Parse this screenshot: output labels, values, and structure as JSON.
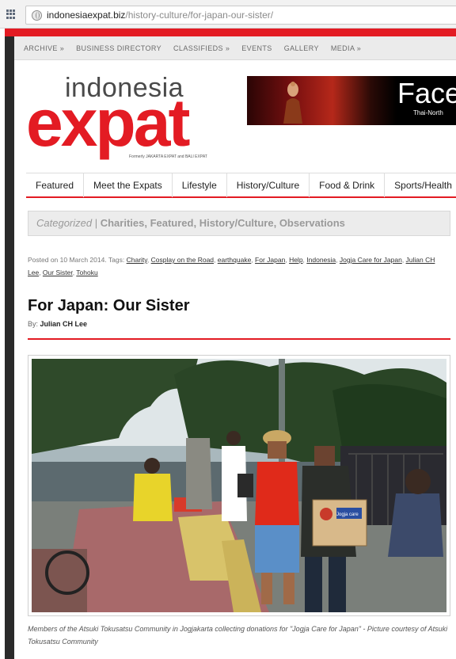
{
  "browser": {
    "url_host": "indonesiaexpat.biz",
    "url_path": "/history-culture/for-japan-our-sister/"
  },
  "topnav": [
    "ARCHIVE »",
    "BUSINESS DIRECTORY",
    "CLASSIFIEDS »",
    "EVENTS",
    "GALLERY",
    "MEDIA »"
  ],
  "logo": {
    "line1": "indonesia",
    "line2": "expat",
    "formerly": "Formerly JAKARTA EXPAT and BALI EXPAT"
  },
  "ad": {
    "title": "Face",
    "subtitle": "Thai-North"
  },
  "mainnav": [
    "Featured",
    "Meet the Expats",
    "Lifestyle",
    "History/Culture",
    "Food & Drink",
    "Sports/Health"
  ],
  "categories": {
    "label": "Categorized",
    "separator": " | ",
    "items": "Charities, Featured, History/Culture, Observations"
  },
  "meta": {
    "posted": "Posted on 10 March 2014. Tags:",
    "tags": [
      "Charity",
      "Cosplay on the Road",
      "earthquake",
      "For Japan",
      "Help",
      "Indonesia",
      "Jogja Care for Japan",
      "Julian CH Lee",
      "Our Sister",
      "Tohoku"
    ]
  },
  "article": {
    "title": "For Japan: Our Sister",
    "byline_prefix": "By:",
    "author": "Julian CH Lee",
    "caption": "Members of the Atsuki Tokusatsu Community in Jogjakarta collecting donations for \"Jogja Care for Japan\" - Picture courtesy of Atsuki Tokusatsu Community",
    "box_label": "Jogja care"
  },
  "colors": {
    "brand_red": "#e31b23",
    "nav_bg": "#ebebeb",
    "cat_bg": "#ececec"
  }
}
